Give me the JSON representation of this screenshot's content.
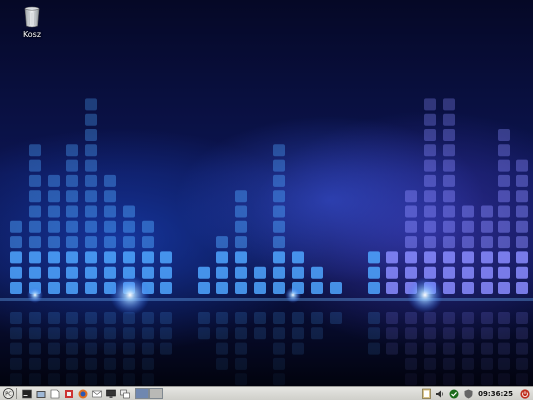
{
  "desktop": {
    "icons": [
      {
        "name": "trash",
        "label": "Kosz"
      }
    ]
  },
  "taskbar": {
    "launchers": [
      "start-menu-icon",
      "terminal-icon",
      "file-manager-icon",
      "text-editor-icon",
      "settings-icon",
      "browser-icon",
      "mail-icon",
      "monitor-icon",
      "windows-icon"
    ],
    "pager": {
      "workspaces": 2,
      "active": 1
    },
    "tray": [
      "clipboard-icon",
      "volume-icon",
      "network-check-icon",
      "shield-icon"
    ],
    "clock": "09:36:25",
    "accent_color": "#6f87b0"
  }
}
